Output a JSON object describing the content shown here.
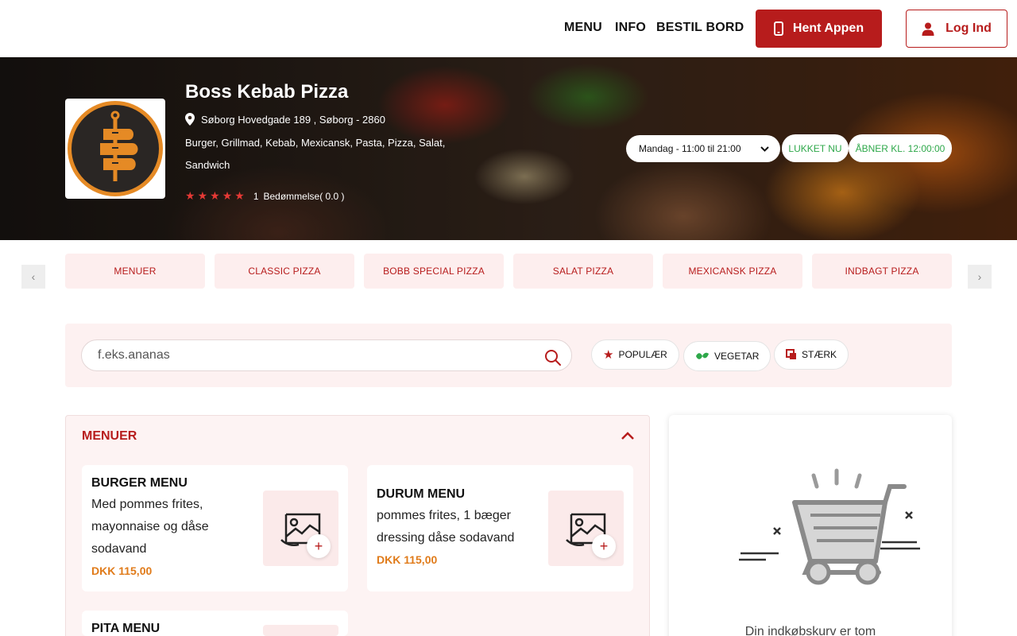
{
  "nav": {
    "menu": "MENU",
    "info": "INFO",
    "book": "BESTIL BORD",
    "app_button": "Hent Appen",
    "login_button": "Log Ind"
  },
  "restaurant": {
    "name": "Boss Kebab Pizza",
    "address": "Søborg Hovedgade 189 , Søborg - 2860",
    "cuisines": "Burger, Grillmad, Kebab, Mexicansk, Pasta, Pizza, Salat, Sandwich",
    "rating_count": "1",
    "rating_text": "Bedømmelse( 0.0 )",
    "stars_filled": 5
  },
  "hours": {
    "selected": "Mandag - 11:00 til 21:00",
    "status": "LUKKET NU",
    "opens": "ÅBNER KL. 12:00:00"
  },
  "categories": [
    "MENUER",
    "CLASSIC PIZZA",
    "BOBB SPECIAL PIZZA",
    "SALAT PIZZA",
    "MEXICANSK PIZZA",
    "INDBAGT PIZZA"
  ],
  "search": {
    "placeholder": "f.eks.ananas"
  },
  "filters": [
    "POPULÆR",
    "VEGETAR",
    "STÆRK"
  ],
  "menu_section": {
    "title": "MENUER",
    "items": [
      {
        "name": "BURGER MENU",
        "description": "Med  pommes frites, mayonnaise og dåse sodavand",
        "price": "DKK 115,00"
      },
      {
        "name": "DURUM MENU",
        "description": "pommes frites, 1 bæger dressing dåse sodavand",
        "price": "DKK 115,00"
      },
      {
        "name": "PITA MENU",
        "description": "",
        "price": ""
      }
    ]
  },
  "cart": {
    "empty_text": "Din indkøbskurv er tom"
  },
  "colors": {
    "brand": "#b71c1c",
    "price": "#e07b1a",
    "status_green": "#2ea84a",
    "star": "#e53935"
  }
}
